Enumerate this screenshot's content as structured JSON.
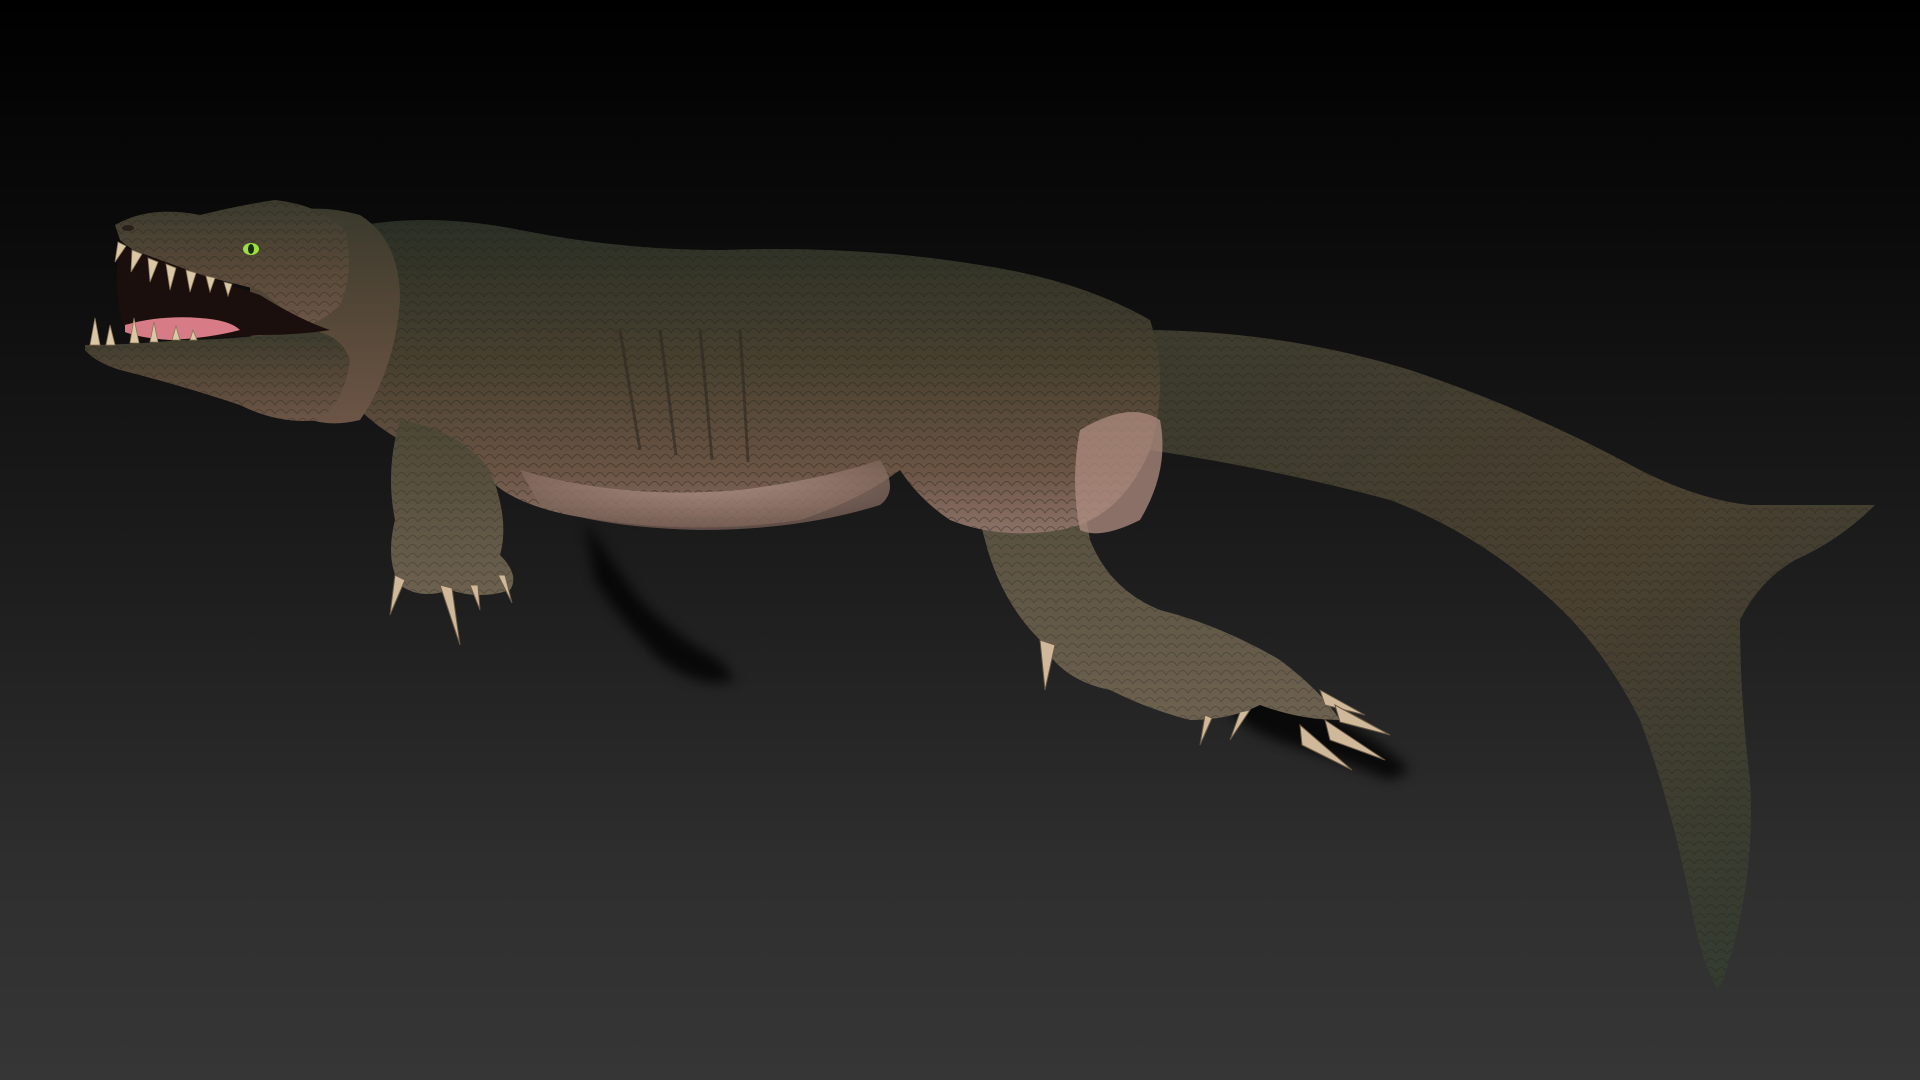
{
  "scene": {
    "subject": "marine-reptile-render",
    "colors": {
      "background_top": "#000000",
      "background_bottom": "#363636",
      "skin_dark": "#2f3428",
      "skin_mid": "#4a4433",
      "skin_warm": "#6b5040",
      "belly": "#a88b82",
      "tooth": "#d9c7a6",
      "tongue": "#d77c86",
      "eye": "#9be03c",
      "shadow": "#000000"
    }
  }
}
